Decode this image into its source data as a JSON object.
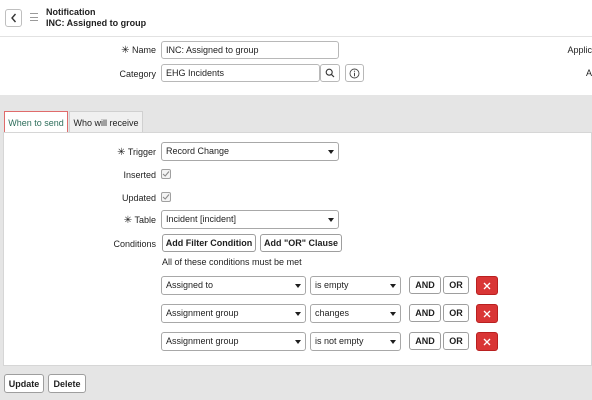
{
  "header": {
    "title": "Notification",
    "subtitle": "INC: Assigned to group"
  },
  "form": {
    "name_label": "Name",
    "name_value": "INC: Assigned to group",
    "category_label": "Category",
    "category_value": "EHG Incidents",
    "right_label_1": "Applic",
    "right_label_2": "A"
  },
  "tabs": [
    {
      "label": "When to send",
      "active": true
    },
    {
      "label": "Who will receive",
      "active": false
    }
  ],
  "when": {
    "trigger_label": "Trigger",
    "trigger_value": "Record Change",
    "inserted_label": "Inserted",
    "inserted_checked": true,
    "updated_label": "Updated",
    "updated_checked": true,
    "table_label": "Table",
    "table_value": "Incident [incident]",
    "conditions_label": "Conditions",
    "add_filter_label": "Add Filter Condition",
    "add_or_label": "Add \"OR\" Clause",
    "conditions_note": "All of these conditions must be met",
    "conditions": [
      {
        "field": "Assigned to",
        "operator": "is empty"
      },
      {
        "field": "Assignment group",
        "operator": "changes"
      },
      {
        "field": "Assignment group",
        "operator": "is not empty"
      }
    ],
    "and_label": "AND",
    "or_label": "OR"
  },
  "footer": {
    "update_label": "Update",
    "delete_label": "Delete"
  },
  "colors": {
    "accent_green": "#2e6e5b",
    "delete_red": "#d93535",
    "active_tab_border": "#e06b6b"
  }
}
